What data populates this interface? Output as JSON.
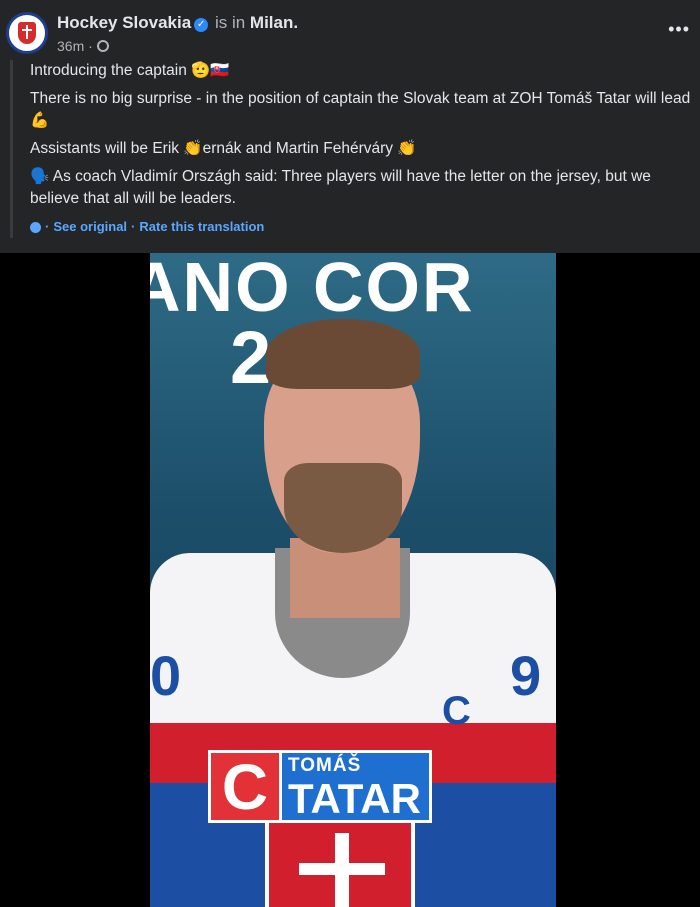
{
  "post": {
    "page_name": "Hockey Slovakia",
    "is_in_label": "is in",
    "place": "Milan.",
    "time_ago": "36m ·",
    "more_label": "•••",
    "paragraphs": [
      "Introducing the captain 🫡🇸🇰",
      "There is no big surprise - in the position of captain the Slovak team at ZOH Tomáš Tatar will lead 💪",
      "Assistants will be Erik 👏ernák and Martin Fehérváry 👏",
      "🗣️ As coach Vladimír Országh said: Three players will have the letter on the jersey, but we believe that all will be leaders."
    ],
    "see_original": "See original",
    "rate_translation": "Rate this translation"
  },
  "media": {
    "banner_text": "ANO COR",
    "banner_year": "2026",
    "jersey_number": "9",
    "jersey_number_left": "0",
    "jersey_c": "C",
    "card_letter": "C",
    "card_first_name": "TOMÁŠ",
    "card_last_name": "TATAR"
  }
}
